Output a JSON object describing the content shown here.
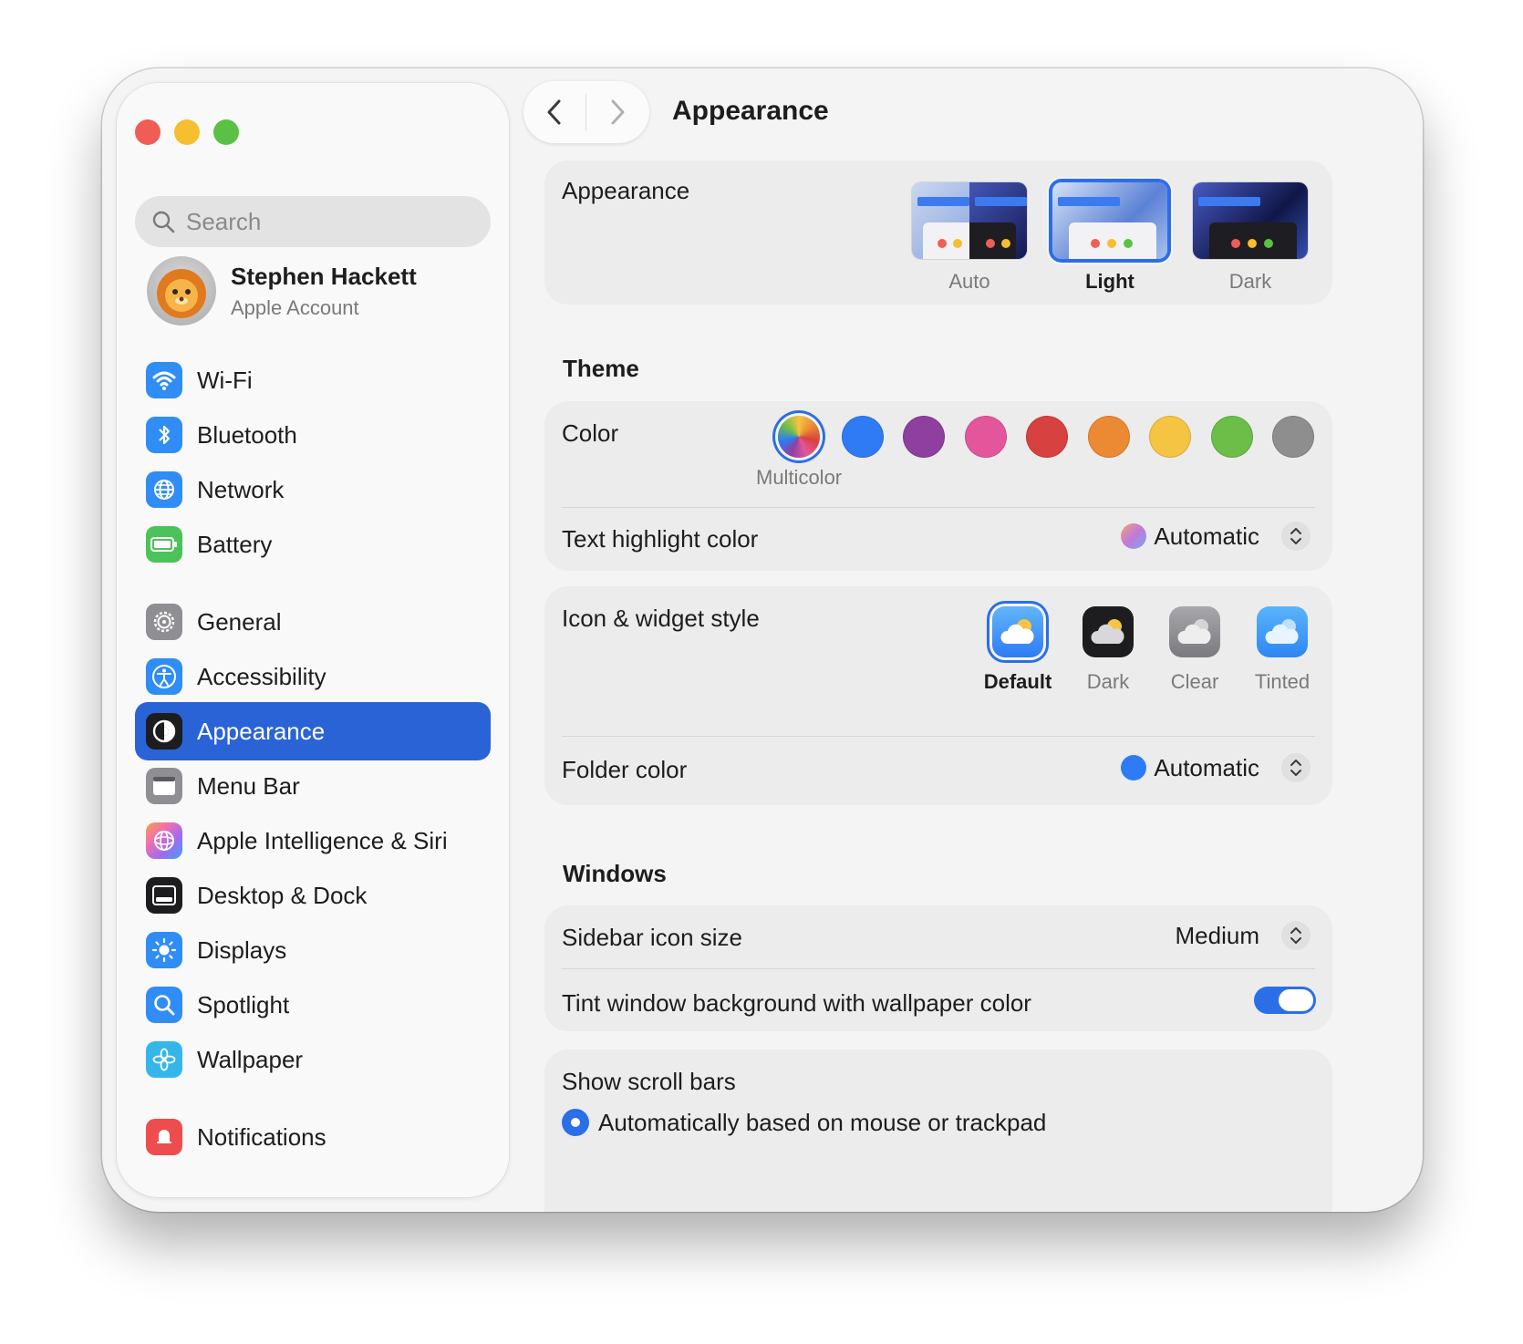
{
  "window": {
    "traffic_lights": [
      {
        "name": "close",
        "color": "#ee5e57"
      },
      {
        "name": "minimize",
        "color": "#f5bf2f"
      },
      {
        "name": "zoom",
        "color": "#5ac145"
      }
    ]
  },
  "sidebar": {
    "search_placeholder": "Search",
    "account": {
      "name": "Stephen Hackett",
      "subtitle": "Apple Account"
    },
    "items": [
      {
        "label": "Wi-Fi",
        "icon": "wifi-icon",
        "color": "#2f8df5"
      },
      {
        "label": "Bluetooth",
        "icon": "bluetooth-icon",
        "color": "#2f8df5"
      },
      {
        "label": "Network",
        "icon": "globe-icon",
        "color": "#2f8df5"
      },
      {
        "label": "Battery",
        "icon": "battery-icon",
        "color": "#4cc25a"
      },
      {
        "label": "General",
        "icon": "gear-icon",
        "color": "#8e8e93"
      },
      {
        "label": "Accessibility",
        "icon": "accessibility-icon",
        "color": "#2f8df5"
      },
      {
        "label": "Appearance",
        "icon": "appearance-icon",
        "color": "#1d1d1f",
        "selected": true
      },
      {
        "label": "Menu Bar",
        "icon": "menubar-icon",
        "color": "#8e8e93"
      },
      {
        "label": "Apple Intelligence & Siri",
        "icon": "siri-icon",
        "color": "#f06fb0"
      },
      {
        "label": "Desktop & Dock",
        "icon": "dock-icon",
        "color": "#1d1d1f"
      },
      {
        "label": "Displays",
        "icon": "sun-icon",
        "color": "#2f8df5"
      },
      {
        "label": "Spotlight",
        "icon": "magnifier-icon",
        "color": "#2f8df5"
      },
      {
        "label": "Wallpaper",
        "icon": "flower-icon",
        "color": "#35b6ea"
      },
      {
        "label": "Notifications",
        "icon": "bell-icon",
        "color": "#ee4d4d"
      }
    ]
  },
  "header": {
    "title": "Appearance"
  },
  "appearance": {
    "label": "Appearance",
    "options": [
      {
        "label": "Auto",
        "selected": false
      },
      {
        "label": "Light",
        "selected": true
      },
      {
        "label": "Dark",
        "selected": false
      }
    ]
  },
  "theme": {
    "heading": "Theme",
    "color_label": "Color",
    "selected_caption": "Multicolor",
    "swatches": [
      "multicolor",
      "#2f7bf5",
      "#8f3fa0",
      "#e4569c",
      "#d7413f",
      "#ec8a33",
      "#f6c443",
      "#6cbe48",
      "#8e8e8e"
    ],
    "highlight_label": "Text highlight color",
    "highlight_value": "Automatic",
    "icon_style_label": "Icon & widget style",
    "icon_styles": [
      {
        "label": "Default",
        "selected": true
      },
      {
        "label": "Dark",
        "selected": false
      },
      {
        "label": "Clear",
        "selected": false
      },
      {
        "label": "Tinted",
        "selected": false
      }
    ],
    "folder_label": "Folder color",
    "folder_value": "Automatic",
    "folder_color": "#2f7bf5"
  },
  "windows": {
    "heading": "Windows",
    "sidebar_icon_label": "Sidebar icon size",
    "sidebar_icon_value": "Medium",
    "tint_label": "Tint window background with wallpaper color",
    "tint_on": true,
    "scrollbars_label": "Show scroll bars",
    "scrollbars_option": "Automatically based on mouse or trackpad"
  },
  "accent_color": "#2a63d6"
}
